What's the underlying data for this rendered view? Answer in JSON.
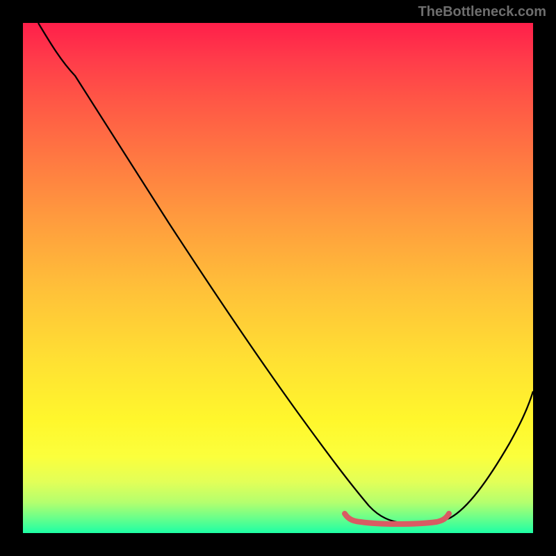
{
  "watermark": "TheBottleneck.com",
  "chart_data": {
    "type": "line",
    "title": "",
    "xlabel": "",
    "ylabel": "",
    "xlim": [
      0,
      100
    ],
    "ylim": [
      0,
      100
    ],
    "gradient_meaning": "vertical red-to-green gradient (red at top = bad / high bottleneck, green at bottom = good / no bottleneck)",
    "series": [
      {
        "name": "bottleneck-curve",
        "color": "#000000",
        "x": [
          3,
          6,
          10,
          20,
          30,
          40,
          50,
          60,
          63,
          68,
          75,
          80,
          82,
          86,
          92,
          100
        ],
        "y_from_top_pct": [
          0,
          6,
          10,
          24,
          38,
          52,
          66,
          80,
          86,
          92,
          97,
          98,
          98,
          97,
          90,
          72
        ]
      },
      {
        "name": "minimum-marker",
        "color": "#d95b63",
        "style": "thick-squiggle",
        "x_range": [
          63,
          83
        ],
        "y_from_top_pct": 97.5
      }
    ]
  }
}
